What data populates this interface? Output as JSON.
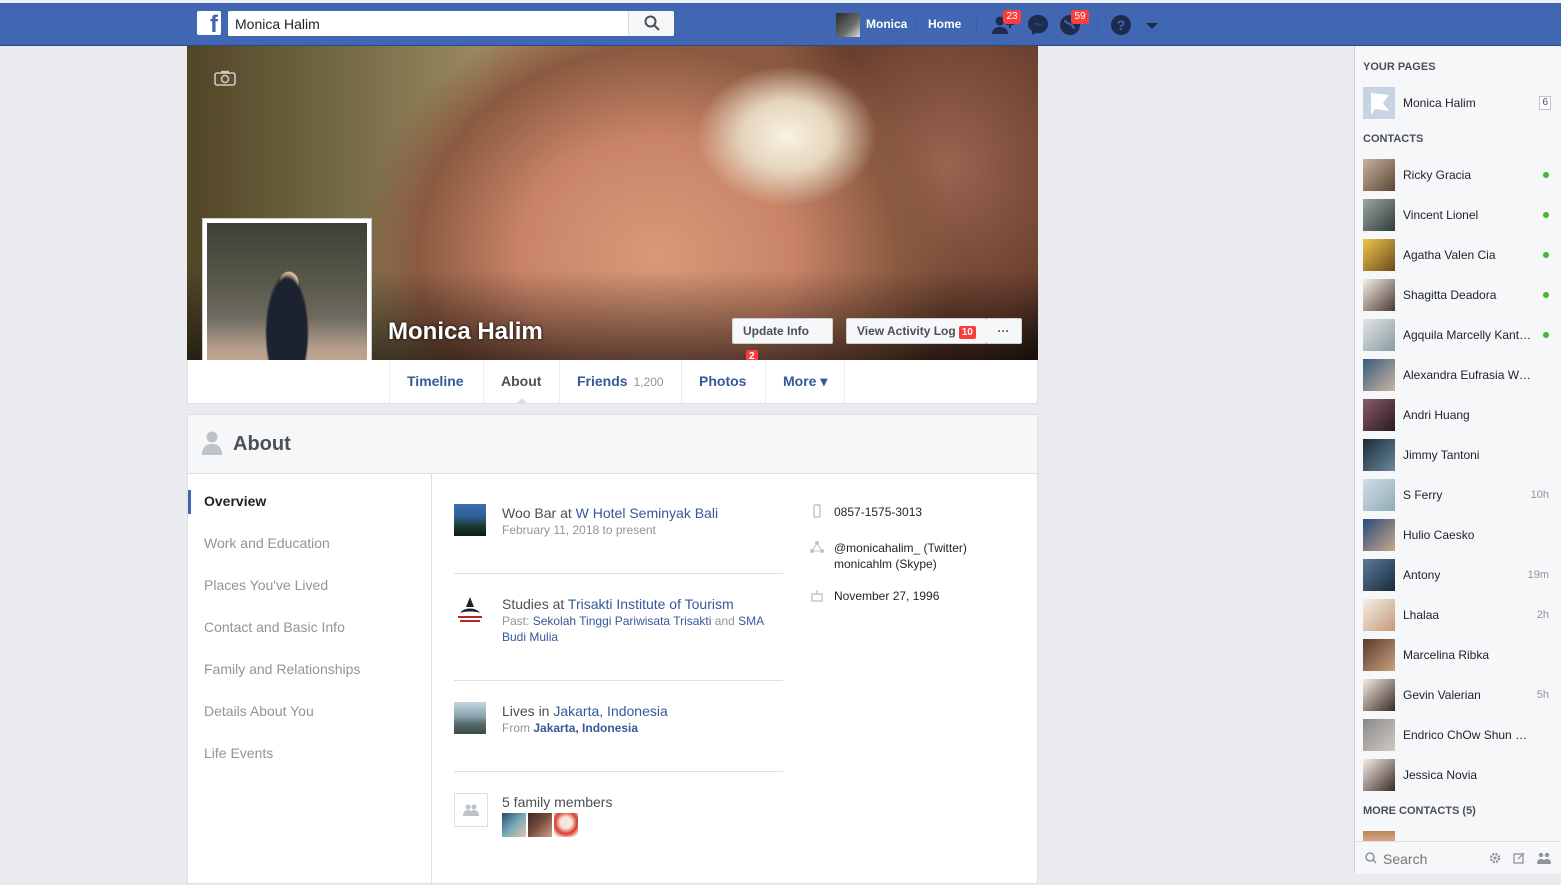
{
  "topbar": {
    "logo": "f",
    "search_value": "Monica Halim",
    "user_name": "Monica",
    "home_label": "Home",
    "friend_requests_count": "23",
    "notifications_count": "59"
  },
  "profile": {
    "name": "Monica Halim",
    "update_info_label": "Update Info",
    "update_info_count": "2",
    "activity_log_label": "View Activity Log",
    "activity_log_count": "10",
    "more_dots": "···"
  },
  "tabs": [
    {
      "label": "Timeline"
    },
    {
      "label": "About"
    },
    {
      "label": "Friends",
      "sub": "1,200"
    },
    {
      "label": "Photos"
    },
    {
      "label": "More ▾"
    }
  ],
  "about": {
    "title": "About",
    "nav": [
      "Overview",
      "Work and Education",
      "Places You've Lived",
      "Contact and Basic Info",
      "Family and Relationships",
      "Details About You",
      "Life Events"
    ],
    "work": {
      "prefix": "Woo Bar at ",
      "place": "W Hotel Seminyak Bali",
      "dates": "February 11, 2018 to present"
    },
    "education": {
      "prefix": "Studies at ",
      "school": "Trisakti Institute of Tourism",
      "past_label": "Past: ",
      "past_1": "Sekolah Tinggi Pariwisata Trisakti",
      "and": " and ",
      "past_2": "SMA Budi Mulia"
    },
    "lives": {
      "prefix": "Lives in ",
      "city": "Jakarta, Indonesia",
      "from_label": "From ",
      "from_city": "Jakarta, Indonesia"
    },
    "family": {
      "label": "5 family members"
    },
    "contact": {
      "phone": "0857-1575-3013",
      "twitter": "@monicahalim_  (Twitter)",
      "skype": "monicahlm  (Skype)",
      "birthday": "November 27, 1996"
    }
  },
  "sidebar": {
    "your_pages_heading": "YOUR PAGES",
    "page": {
      "name": "Monica Halim",
      "count": "6"
    },
    "contacts_heading": "CONTACTS",
    "contacts": [
      {
        "name": "Ricky Gracia",
        "status": "online"
      },
      {
        "name": "Vincent Lionel",
        "status": "online"
      },
      {
        "name": "Agatha Valen Cia",
        "status": "online"
      },
      {
        "name": "Shagitta Deadora",
        "status": "online"
      },
      {
        "name": "Agquila Marcelly Kanthika",
        "status": "online"
      },
      {
        "name": "Alexandra Eufrasia Welly",
        "status": ""
      },
      {
        "name": "Andri Huang",
        "status": ""
      },
      {
        "name": "Jimmy Tantoni",
        "status": ""
      },
      {
        "name": "S Ferry",
        "status": "10h"
      },
      {
        "name": "Hulio Caesko",
        "status": ""
      },
      {
        "name": "Antony",
        "status": "19m"
      },
      {
        "name": "Lhalaa",
        "status": "2h"
      },
      {
        "name": "Marcelina Ribka",
        "status": ""
      },
      {
        "name": "Gevin Valerian",
        "status": "5h"
      },
      {
        "name": "Endrico ChOw Shun Qiang",
        "status": ""
      },
      {
        "name": "Jessica Novia",
        "status": ""
      }
    ],
    "more_contacts_heading": "MORE CONTACTS (5)",
    "search_placeholder": "Search"
  },
  "colors": {
    "brand": "#4267b2",
    "online": "#42b72a",
    "badge": "#fa3e3e"
  }
}
